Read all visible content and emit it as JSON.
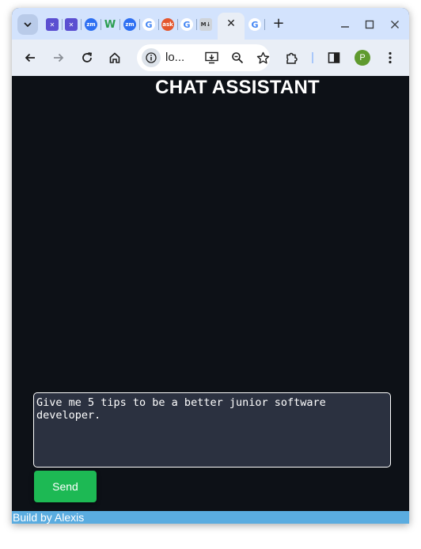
{
  "browser": {
    "tabs": [
      {
        "icon": "tools-icon",
        "color": "#5b4fd1",
        "glyph": "✕"
      },
      {
        "icon": "tools-icon",
        "color": "#5b4fd1",
        "glyph": "✕"
      },
      {
        "icon": "zoom-icon",
        "color": "#2d6ff2",
        "glyph": "zm"
      },
      {
        "icon": "w-icon",
        "color": "#2a9d4e",
        "glyph": "W"
      },
      {
        "icon": "zoom-icon",
        "color": "#2d6ff2",
        "glyph": "zm"
      },
      {
        "icon": "google-icon",
        "color": "#ffffff",
        "glyph": "G"
      },
      {
        "icon": "ask-icon",
        "color": "#e4572e",
        "glyph": "ask"
      },
      {
        "icon": "google-icon",
        "color": "#ffffff",
        "glyph": "G"
      },
      {
        "icon": "markdown-icon",
        "color": "#cfd4da",
        "glyph": "M↓"
      }
    ],
    "new_tab_icon": "plus-icon",
    "omnibox_url": "lo...",
    "avatar_letter": "P",
    "accent_color": "#d3e3fd"
  },
  "page": {
    "title": "CHAT ASSISTANT",
    "input_value": "Give me 5 tips to be a better junior software developer.",
    "send_label": "Send",
    "footer_text": "Build by Alexis",
    "background_color": "#0d1117",
    "send_color": "#1db954",
    "footer_color": "#5aace0"
  }
}
